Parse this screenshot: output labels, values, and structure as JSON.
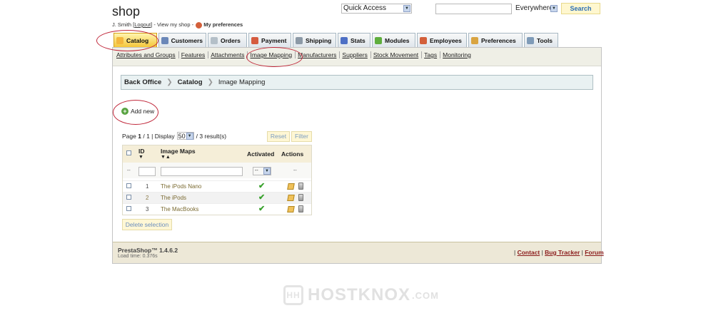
{
  "header": {
    "shop_name": "shop",
    "user_name": "J. Smith",
    "logout_label": "Logout",
    "view_shop_label": "View my shop",
    "preferences_label": "My preferences",
    "quick_access": "Quick Access",
    "search_scope": "Everywhere",
    "search_button": "Search",
    "search_value": ""
  },
  "tabs": [
    {
      "label": "Catalog",
      "icon": "folder-icon",
      "active": true
    },
    {
      "label": "Customers",
      "icon": "customers-icon"
    },
    {
      "label": "Orders",
      "icon": "orders-icon"
    },
    {
      "label": "Payment",
      "icon": "payment-icon"
    },
    {
      "label": "Shipping",
      "icon": "truck-icon"
    },
    {
      "label": "Stats",
      "icon": "stats-icon"
    },
    {
      "label": "Modules",
      "icon": "puzzle-icon"
    },
    {
      "label": "Employees",
      "icon": "employees-icon"
    },
    {
      "label": "Preferences",
      "icon": "preferences-icon"
    },
    {
      "label": "Tools",
      "icon": "tools-icon"
    }
  ],
  "submenu": [
    "Attributes and Groups",
    "Features",
    "Attachments",
    "Image Mapping",
    "Manufacturers",
    "Suppliers",
    "Stock Movement",
    "Tags",
    "Monitoring"
  ],
  "breadcrumb": {
    "root": "Back Office",
    "section": "Catalog",
    "current": "Image Mapping"
  },
  "add_new_label": "Add new",
  "pagination": {
    "page_label": "Page",
    "page_current": "1",
    "page_total": "1",
    "display_label": "Display",
    "per_page": "50",
    "results": "/ 3 result(s)"
  },
  "buttons": {
    "reset": "Reset",
    "filter": "Filter",
    "delete_selection": "Delete selection"
  },
  "table": {
    "columns": {
      "id": "ID",
      "name": "Image Maps",
      "activated": "Activated",
      "actions": "Actions"
    },
    "filter_placeholder": "--",
    "activated_filter": "--",
    "actions_filter": "--",
    "rows": [
      {
        "id": "1",
        "name": "The iPods Nano",
        "activated": true
      },
      {
        "id": "2",
        "name": "The iPods",
        "activated": true
      },
      {
        "id": "3",
        "name": "The MacBooks",
        "activated": true
      }
    ]
  },
  "footer": {
    "version": "PrestaShop™ 1.4.6.2",
    "load_time": "Load time: 0.376s",
    "contact": "Contact",
    "bug_tracker": "Bug Tracker",
    "forum": "Forum"
  },
  "watermark": {
    "name": "HOSTKNOX",
    "suffix": ".COM"
  },
  "colors": {
    "active_tab": "#f4c63a",
    "annotation_circle": "#c0273a",
    "breadcrumb_bg": "#e9f1f2",
    "footer_bg": "#ede8d7"
  }
}
